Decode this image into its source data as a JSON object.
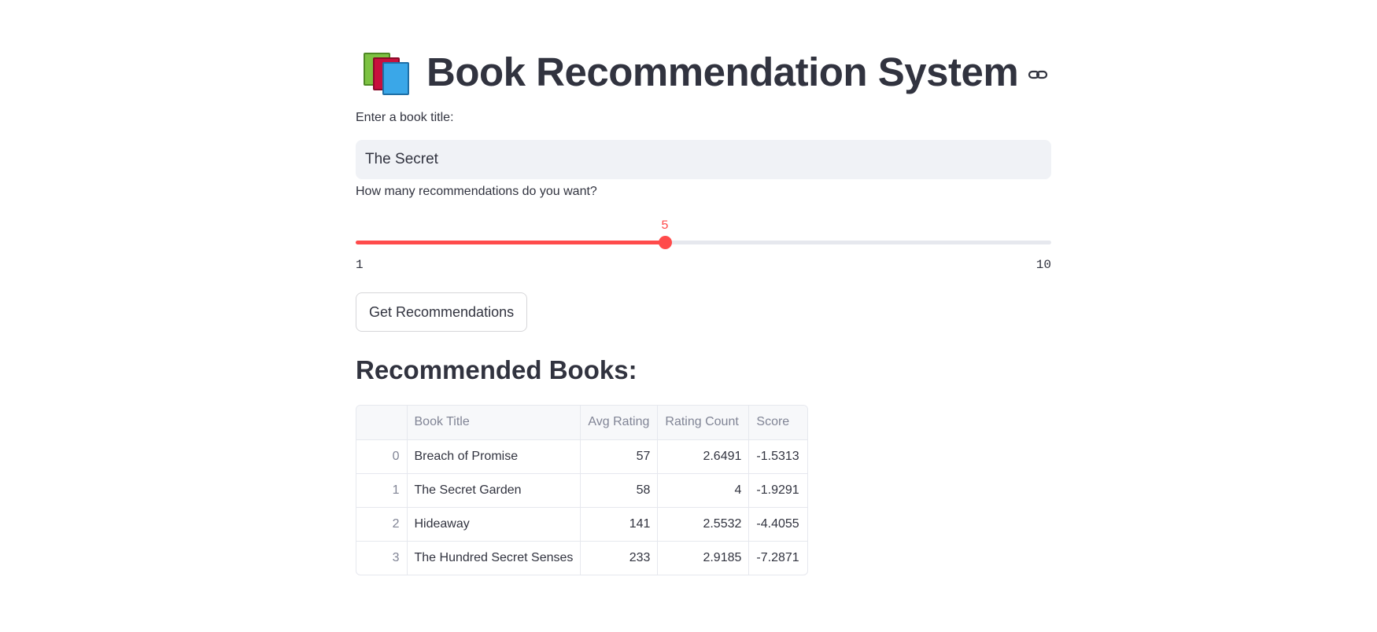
{
  "page": {
    "title": "Book Recommendation System",
    "title_icon": "books-emoji-icon",
    "link_icon": "link-icon"
  },
  "book_input": {
    "label": "Enter a book title:",
    "value": "The Secret",
    "placeholder": ""
  },
  "slider": {
    "label": "How many recommendations do you want?",
    "min": 1,
    "max": 10,
    "value": 5,
    "min_label": "1",
    "max_label": "10",
    "value_label": "5",
    "accent_color": "#ff4b4b"
  },
  "button": {
    "label": "Get Recommendations"
  },
  "results": {
    "heading": "Recommended Books:",
    "columns": [
      "",
      "Book Title",
      "Avg Rating",
      "Rating Count",
      "Score"
    ],
    "rows": [
      {
        "index": "0",
        "title": "Breach of Promise",
        "avg_rating": "57",
        "rating_count": "2.6491",
        "score": "-1.5313"
      },
      {
        "index": "1",
        "title": "The Secret Garden",
        "avg_rating": "58",
        "rating_count": "4",
        "score": "-1.9291"
      },
      {
        "index": "2",
        "title": "Hideaway",
        "avg_rating": "141",
        "rating_count": "2.5532",
        "score": "-4.4055"
      },
      {
        "index": "3",
        "title": "The Hundred Secret Senses",
        "avg_rating": "233",
        "rating_count": "2.9185",
        "score": "-7.2871"
      }
    ]
  }
}
